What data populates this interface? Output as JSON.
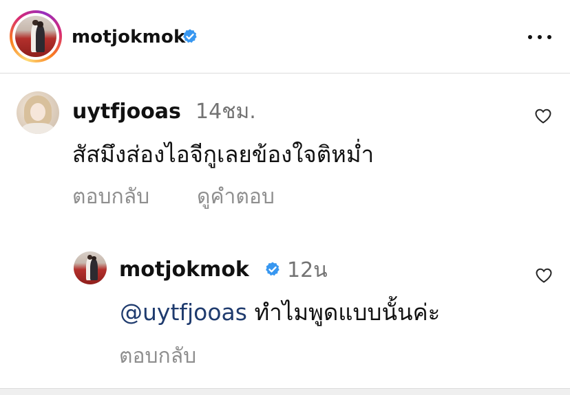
{
  "header": {
    "username": "motjokmok",
    "verified": true,
    "more_icon": "more-horizontal-icon"
  },
  "comments": [
    {
      "username": "uytfjooas",
      "time": "14ชม.",
      "text": "สัสมึงส่องไอจีกูเลยข้องใจติหม่ำ",
      "reply_label": "ตอบกลับ",
      "view_replies_label": "ดูคำตอบ",
      "like_icon": "heart-outline-icon"
    }
  ],
  "reply": {
    "username": "motjokmok",
    "verified": true,
    "time": "12น",
    "mention": "@uytfjooas",
    "text": "ทำไมพูดแบบนั้นค่ะ",
    "reply_label": "ตอบกลับ",
    "like_icon": "heart-outline-icon"
  },
  "colors": {
    "verified_blue": "#3897f0",
    "mention": "#1f3b6e",
    "secondary_text": "#8e8e8e"
  }
}
